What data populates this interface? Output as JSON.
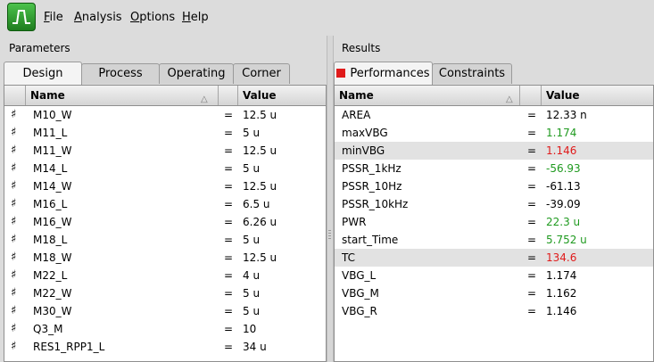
{
  "menu": {
    "items": [
      {
        "key": "F",
        "rest": "ile"
      },
      {
        "key": "A",
        "rest": "nalysis"
      },
      {
        "key": "O",
        "rest": "ptions"
      },
      {
        "key": "H",
        "rest": "elp"
      }
    ]
  },
  "parameters": {
    "title": "Parameters",
    "tabs": [
      "Design",
      "Process",
      "Operating",
      "Corner"
    ],
    "active_tab": "Design",
    "columns": {
      "name": "Name",
      "value": "Value"
    },
    "rows": [
      {
        "name": "M10_W",
        "eq": "=",
        "value": "12.5 u"
      },
      {
        "name": "M11_L",
        "eq": "=",
        "value": "5 u"
      },
      {
        "name": "M11_W",
        "eq": "=",
        "value": "12.5 u"
      },
      {
        "name": "M14_L",
        "eq": "=",
        "value": "5 u"
      },
      {
        "name": "M14_W",
        "eq": "=",
        "value": "12.5 u"
      },
      {
        "name": "M16_L",
        "eq": "=",
        "value": "6.5 u"
      },
      {
        "name": "M16_W",
        "eq": "=",
        "value": "6.26 u"
      },
      {
        "name": "M18_L",
        "eq": "=",
        "value": "5 u"
      },
      {
        "name": "M18_W",
        "eq": "=",
        "value": "12.5 u"
      },
      {
        "name": "M22_L",
        "eq": "=",
        "value": "4 u"
      },
      {
        "name": "M22_W",
        "eq": "=",
        "value": "5 u"
      },
      {
        "name": "M30_W",
        "eq": "=",
        "value": "5 u"
      },
      {
        "name": "Q3_M",
        "eq": "=",
        "value": "10"
      },
      {
        "name": "RES1_RPP1_L",
        "eq": "=",
        "value": "34 u"
      }
    ]
  },
  "results": {
    "title": "Results",
    "tabs": [
      "Performances",
      "Constraints"
    ],
    "active_tab": "Performances",
    "columns": {
      "name": "Name",
      "value": "Value"
    },
    "rows": [
      {
        "name": "AREA",
        "eq": "=",
        "value": "12.33 n",
        "color": "black"
      },
      {
        "name": "maxVBG",
        "eq": "=",
        "value": "1.174",
        "color": "green"
      },
      {
        "name": "minVBG",
        "eq": "=",
        "value": "1.146",
        "color": "red",
        "selected": true
      },
      {
        "name": "PSSR_1kHz",
        "eq": "=",
        "value": "-56.93",
        "color": "green"
      },
      {
        "name": "PSSR_10Hz",
        "eq": "=",
        "value": "-61.13",
        "color": "black"
      },
      {
        "name": "PSSR_10kHz",
        "eq": "=",
        "value": "-39.09",
        "color": "black"
      },
      {
        "name": "PWR",
        "eq": "=",
        "value": "22.3 u",
        "color": "green"
      },
      {
        "name": "start_Time",
        "eq": "=",
        "value": "5.752 u",
        "color": "green"
      },
      {
        "name": "TC",
        "eq": "=",
        "value": "134.6",
        "color": "red",
        "selected": true
      },
      {
        "name": "VBG_L",
        "eq": "=",
        "value": "1.174",
        "color": "black"
      },
      {
        "name": "VBG_M",
        "eq": "=",
        "value": "1.162",
        "color": "black"
      },
      {
        "name": "VBG_R",
        "eq": "=",
        "value": "1.146",
        "color": "black"
      }
    ]
  },
  "colors": {
    "good": "#1f9a1f",
    "bad": "#e01b1b",
    "indicator": "#e01b1b"
  }
}
